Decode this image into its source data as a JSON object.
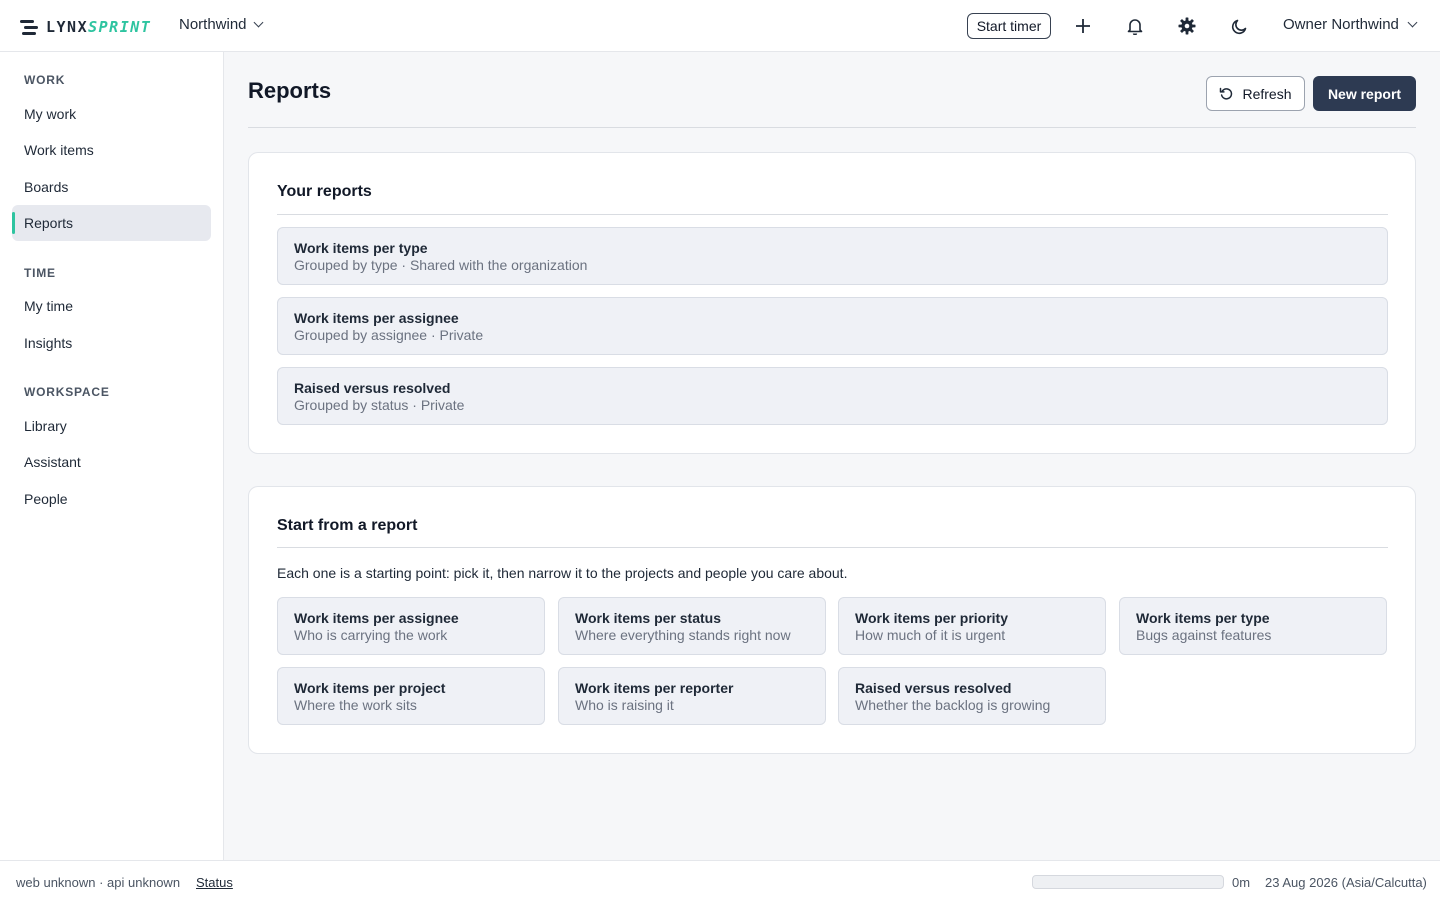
{
  "brand": {
    "part1": "LYNX",
    "part2": "SPRINT",
    "accent": "#2ec4a0"
  },
  "header": {
    "org": "Northwind",
    "start_timer": "Start timer",
    "icons": [
      "plus-icon",
      "bell-icon",
      "gear-icon",
      "moon-icon"
    ],
    "user": "Owner Northwind"
  },
  "sidebar": {
    "sections": [
      {
        "label": "WORK",
        "items": [
          "My work",
          "Work items",
          "Boards",
          "Reports"
        ]
      },
      {
        "label": "TIME",
        "items": [
          "My time",
          "Insights"
        ]
      },
      {
        "label": "WORKSPACE",
        "items": [
          "Library",
          "Assistant",
          "People"
        ]
      }
    ],
    "active": "Reports"
  },
  "page": {
    "title": "Reports",
    "refresh_label": "Refresh",
    "new_report_label": "New report"
  },
  "your_reports": {
    "title": "Your reports",
    "items": [
      {
        "title": "Work items per type",
        "subtitle": "Grouped by type · Shared with the organization"
      },
      {
        "title": "Work items per assignee",
        "subtitle": "Grouped by assignee · Private"
      },
      {
        "title": "Raised versus resolved",
        "subtitle": "Grouped by status · Private"
      }
    ]
  },
  "start_from": {
    "title": "Start from a report",
    "intro": "Each one is a starting point: pick it, then narrow it to the projects and people you care about.",
    "templates": [
      {
        "title": "Work items per assignee",
        "subtitle": "Who is carrying the work"
      },
      {
        "title": "Work items per status",
        "subtitle": "Where everything stands right now"
      },
      {
        "title": "Work items per priority",
        "subtitle": "How much of it is urgent"
      },
      {
        "title": "Work items per type",
        "subtitle": "Bugs against features"
      },
      {
        "title": "Work items per project",
        "subtitle": "Where the work sits"
      },
      {
        "title": "Work items per reporter",
        "subtitle": "Who is raising it"
      },
      {
        "title": "Raised versus resolved",
        "subtitle": "Whether the backlog is growing"
      }
    ]
  },
  "footer": {
    "versions": "web unknown · api unknown",
    "status_link": "Status",
    "timer_progress": 0,
    "timer": "0m",
    "date": "23 Aug 2026 (Asia/Calcutta)"
  }
}
